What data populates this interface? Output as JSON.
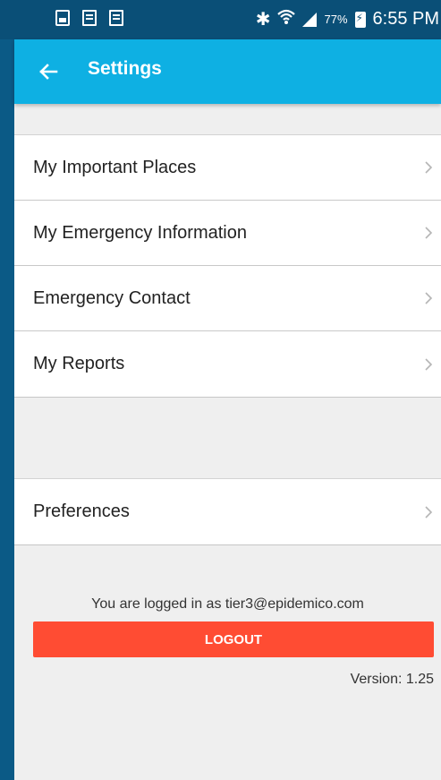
{
  "status_bar": {
    "battery_percent": "77%",
    "time": "6:55 PM",
    "icons": [
      "photo-icon",
      "document-icon",
      "doc-x-icon",
      "bluetooth-icon",
      "wifi-icon",
      "signal-icon",
      "battery-icon"
    ]
  },
  "toolbar": {
    "title": "Settings",
    "back_icon": "arrow-left-icon",
    "color": "#0eb0e3"
  },
  "menu": {
    "items": [
      {
        "label": "My Important Places"
      },
      {
        "label": "My Emergency Information"
      },
      {
        "label": "Emergency Contact"
      },
      {
        "label": "My Reports"
      }
    ]
  },
  "preferences": {
    "label": "Preferences"
  },
  "account": {
    "logged_in_text": "You are logged in as tier3@epidemico.com",
    "logout_label": "LOGOUT",
    "logout_color": "#ff4c33",
    "version": "Version: 1.25"
  }
}
